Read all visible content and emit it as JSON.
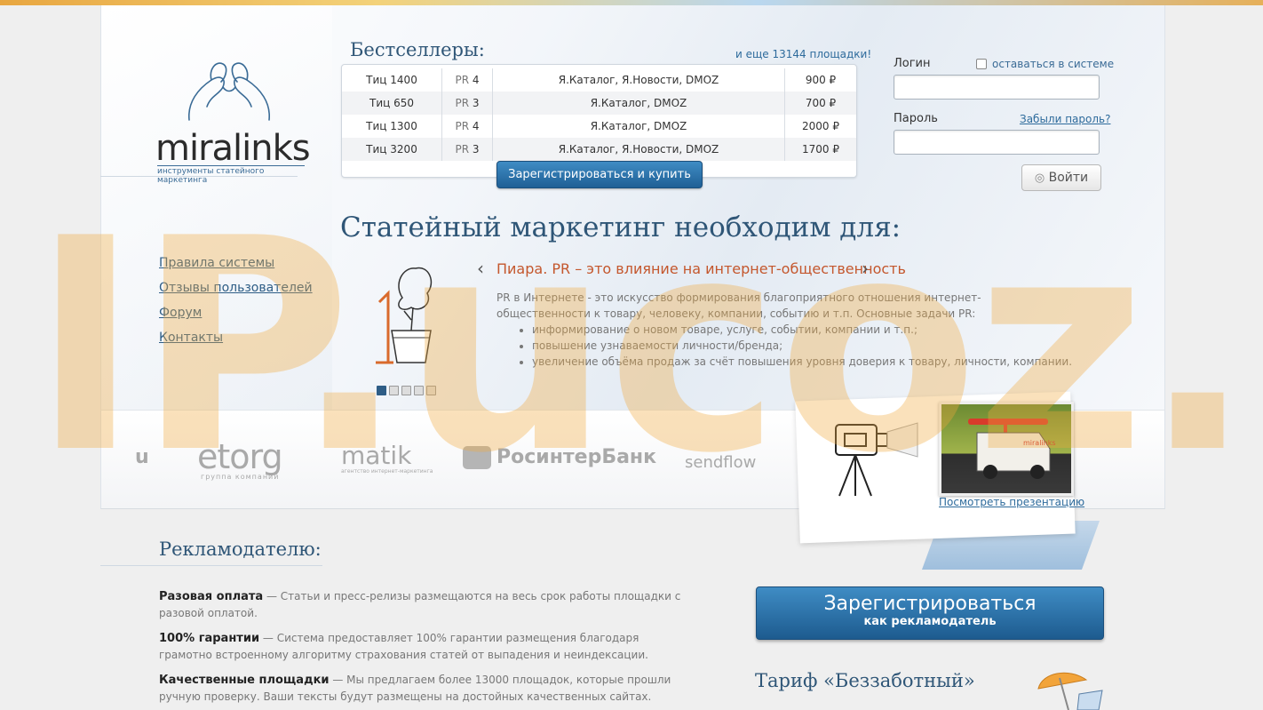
{
  "logo": {
    "word": "miralinks",
    "tagline": "инструменты статейного маркетинга"
  },
  "bestsellers": {
    "title": "Бестселлеры:",
    "more_link": "и еще 13144 площадки!",
    "rows": [
      {
        "tic": "Тиц 1400",
        "pr_label": "PR",
        "pr": "4",
        "catalogs": "Я.Каталог, Я.Новости, DMOZ",
        "price": "900 ₽"
      },
      {
        "tic": "Тиц 650",
        "pr_label": "PR",
        "pr": "3",
        "catalogs": "Я.Каталог, DMOZ",
        "price": "700 ₽"
      },
      {
        "tic": "Тиц 1300",
        "pr_label": "PR",
        "pr": "4",
        "catalogs": "Я.Каталог, DMOZ",
        "price": "2000 ₽"
      },
      {
        "tic": "Тиц 3200",
        "pr_label": "PR",
        "pr": "3",
        "catalogs": "Я.Каталог, Я.Новости, DMOZ",
        "price": "1700 ₽"
      }
    ],
    "buy_button": "Зарегистрироваться и купить"
  },
  "login": {
    "login_label": "Логин",
    "remember_label": "оставаться в системе",
    "password_label": "Пароль",
    "forgot_link": "Забыли пароль?",
    "submit": "Войти"
  },
  "headline": "Статейный маркетинг необходим для:",
  "menu": [
    "Правила системы",
    "Отзывы пользователей",
    "Форум",
    "Контакты"
  ],
  "slide": {
    "title": "Пиара. PR – это влияние на интернет-общественность",
    "text": "PR в Интернете - это искусство формирования благоприятного отношения интернет-общественности к товару, человеку, компании, событию и т.п. Основные задачи PR:",
    "bullets": [
      "информирование о новом товаре, услуге, событии, компании и т.п.;",
      "повышение узнаваемости личности/бренда;",
      "увеличение объёма продаж за счёт повышения уровня доверия к товару, личности, компании."
    ],
    "dots": 5,
    "active_dot": 0
  },
  "partners": {
    "logo1": "u",
    "logo2": "etorg",
    "logo2_sub": "группа компаний",
    "logo3": "matik",
    "logo3_sub": "агентство интернет-маркетинга",
    "logo4": "РосинтерБанк",
    "logo5": "sendflow"
  },
  "presentation": {
    "thumb_label": "miralinks",
    "link": "Посмотреть презентацию"
  },
  "advertiser": {
    "title": "Рекламодателю:",
    "items": [
      {
        "head": "Разовая оплата",
        "text": " — Статьи и пресс-релизы размещаются на весь срок работы площадки с разовой оплатой."
      },
      {
        "head": "100% гарантии",
        "text": " — Система предоставляет 100% гарантии размещения благодаря грамотно встроенному алгоритму страхования статей от выпадения и неиндексации."
      },
      {
        "head": "Качественные площадки",
        "text": " — Мы предлагаем более 13000 площадок, которые прошли ручную проверку. Ваши тексты будут размещены на достойных качественных сайтах."
      }
    ],
    "register_main": "Зарегистрироваться",
    "register_sub": "как рекламодатель",
    "tariff": "Тариф «Беззаботный»"
  },
  "watermark": "IP.ucoz.ua"
}
